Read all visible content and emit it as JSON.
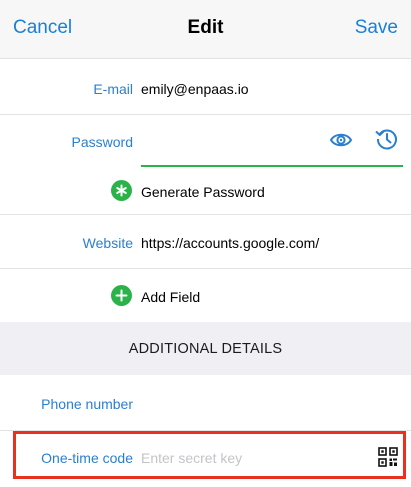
{
  "nav": {
    "cancel_label": "Cancel",
    "title": "Edit",
    "save_label": "Save"
  },
  "fields": {
    "email_label": "E-mail",
    "email_value": "emily@enpaas.io",
    "password_label": "Password",
    "password_value": "",
    "generate_password_label": "Generate Password",
    "website_label": "Website",
    "website_value": "https://accounts.google.com/",
    "add_field_label": "Add Field"
  },
  "additional": {
    "section_title": "ADDITIONAL DETAILS",
    "phone_label": "Phone number",
    "phone_value": "",
    "otp_label": "One-time code",
    "otp_placeholder": "Enter secret key"
  },
  "colors": {
    "accent_blue": "#1a7fd6",
    "green": "#2bb34a",
    "highlight_red": "#e8321f"
  },
  "icons": [
    "eye-icon",
    "history-icon",
    "asterisk-icon",
    "plus-icon",
    "qr-code-icon"
  ]
}
